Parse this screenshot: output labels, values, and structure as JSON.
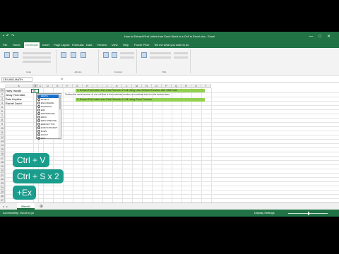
{
  "window": {
    "title": "How to Extract First Letter from Each Word in a Cell in Excel.xlsx - Excel",
    "controls": [
      "—",
      "□",
      "✕"
    ]
  },
  "qat": [
    "save-icon",
    "undo-icon",
    "redo-icon"
  ],
  "ribbon_tabs": [
    "File",
    "Home",
    "Developer",
    "Insert",
    "Page Layout",
    "Formulas",
    "Data",
    "Review",
    "View",
    "Help",
    "Power Pivot"
  ],
  "active_tab": "Developer",
  "tellme": "Tell me what you want to do",
  "ribbon_groups": [
    {
      "label": "Code"
    },
    {
      "label": "Add-ins"
    },
    {
      "label": "Controls"
    },
    {
      "label": "XML"
    }
  ],
  "formula_bar": {
    "name_box": "CEILING.MATH",
    "fx": "fx"
  },
  "columns": [
    "A",
    "B",
    "C",
    "D",
    "E",
    "F",
    "G",
    "H",
    "I",
    "J",
    "K",
    "L",
    "M",
    "N",
    "O",
    "P",
    "Q",
    "R",
    "S",
    "T"
  ],
  "rows": [
    "1",
    "2",
    "3",
    "4",
    "5",
    "6",
    "7",
    "8",
    "9",
    "10",
    "11",
    "12",
    "13",
    "14",
    "15",
    "16",
    "17",
    "18",
    "19",
    "20",
    "21",
    "22",
    "23",
    "24",
    "25",
    "26",
    "27",
    "28",
    "29",
    "30",
    "31",
    "32"
  ],
  "cells": {
    "A1": "Harry Handle",
    "A2": "Jessy Thorndike",
    "A3": "Dale Hopkins",
    "A4": "Rachel David",
    "B1": "=E"
  },
  "banners": {
    "banner1": "1. Extract First Letter from Each Word in a Cell Using User Defined Function with VBA Code",
    "note": "Textbox the serial number of one cell that is the combined number of combined text is to the desired area",
    "banner2": "2. Extract First Letter from Each Word in a Cell Using Excel Formula"
  },
  "autocomplete": {
    "items": [
      "EDATE",
      "EFFECT",
      "ENCODEURL",
      "EOMONTH",
      "ERF",
      "ERF.PRECISE",
      "ERFC",
      "ERFC.PRECISE",
      "ERROR.TYPE",
      "EUROCONVERT",
      "EVEN",
      "EXACT",
      "EXP"
    ],
    "selected_index": 0
  },
  "keystrokes": [
    "Ctrl + V",
    "Ctrl + S x 2",
    "+Ex"
  ],
  "sheet_tabs": [
    "Sheet1"
  ],
  "statusbar": {
    "left": "Accessibility: Good to go",
    "right": "Display Settings"
  }
}
